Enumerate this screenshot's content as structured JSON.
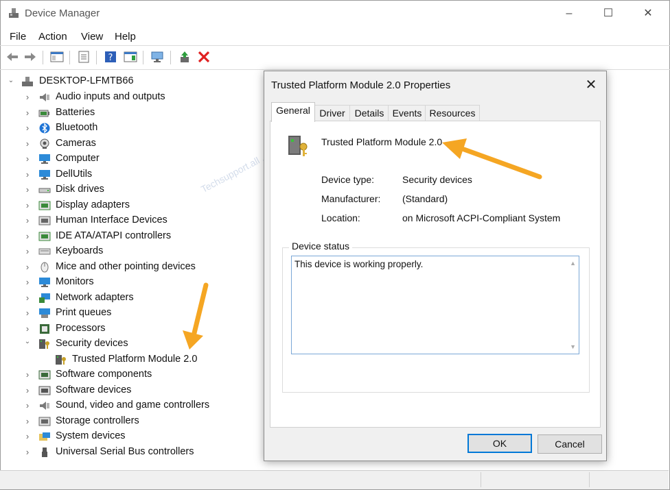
{
  "window": {
    "title": "Device Manager",
    "controls": {
      "minimize": "–",
      "maximize": "☐",
      "close": "✕"
    }
  },
  "menu": [
    "File",
    "Action",
    "View",
    "Help"
  ],
  "tree": {
    "root": "DESKTOP-LFMTB66",
    "items": [
      {
        "label": "Audio inputs and outputs",
        "icon": "speaker-icon",
        "color": "#7a7a7a"
      },
      {
        "label": "Batteries",
        "icon": "battery-icon",
        "color": "#3a8a3a"
      },
      {
        "label": "Bluetooth",
        "icon": "bluetooth-icon",
        "color": "#1e74d6"
      },
      {
        "label": "Cameras",
        "icon": "camera-icon",
        "color": "#555555"
      },
      {
        "label": "Computer",
        "icon": "monitor-icon",
        "color": "#2c8ad8"
      },
      {
        "label": "DellUtils",
        "icon": "monitor-icon",
        "color": "#2c8ad8"
      },
      {
        "label": "Disk drives",
        "icon": "disk-icon",
        "color": "#666666"
      },
      {
        "label": "Display adapters",
        "icon": "display-adapter-icon",
        "color": "#3a8a3a"
      },
      {
        "label": "Human Interface Devices",
        "icon": "hid-icon",
        "color": "#666666"
      },
      {
        "label": "IDE ATA/ATAPI controllers",
        "icon": "ide-icon",
        "color": "#3a8a3a"
      },
      {
        "label": "Keyboards",
        "icon": "keyboard-icon",
        "color": "#777777"
      },
      {
        "label": "Mice and other pointing devices",
        "icon": "mouse-icon",
        "color": "#777777"
      },
      {
        "label": "Monitors",
        "icon": "monitor-icon",
        "color": "#2c8ad8"
      },
      {
        "label": "Network adapters",
        "icon": "network-icon",
        "color": "#2c8ad8"
      },
      {
        "label": "Print queues",
        "icon": "printer-icon",
        "color": "#2c8ad8"
      },
      {
        "label": "Processors",
        "icon": "cpu-icon",
        "color": "#3a6a3a"
      },
      {
        "label": "Security devices",
        "icon": "security-key-icon",
        "color": "#c9a227",
        "expanded": true
      },
      {
        "label": "Trusted Platform Module 2.0",
        "icon": "security-key-icon",
        "color": "#c9a227",
        "child": true
      },
      {
        "label": "Software components",
        "icon": "software-component-icon",
        "color": "#3a6a3a"
      },
      {
        "label": "Software devices",
        "icon": "software-device-icon",
        "color": "#555555"
      },
      {
        "label": "Sound, video and game controllers",
        "icon": "speaker-icon",
        "color": "#7a7a7a"
      },
      {
        "label": "Storage controllers",
        "icon": "storage-icon",
        "color": "#666666"
      },
      {
        "label": "System devices",
        "icon": "folder-monitor-icon",
        "color": "#2c8ad8"
      },
      {
        "label": "Universal Serial Bus controllers",
        "icon": "usb-icon",
        "color": "#555555"
      }
    ]
  },
  "dialog": {
    "title": "Trusted Platform Module 2.0 Properties",
    "close": "✕",
    "tabs": [
      "General",
      "Driver",
      "Details",
      "Events",
      "Resources"
    ],
    "device_name": "Trusted Platform Module 2.0",
    "fields": [
      {
        "label": "Device type:",
        "value": "Security devices"
      },
      {
        "label": "Manufacturer:",
        "value": "(Standard)"
      },
      {
        "label": "Location:",
        "value": "on Microsoft ACPI-Compliant System"
      }
    ],
    "status_group": "Device status",
    "status_text": "This device is working properly.",
    "ok": "OK",
    "cancel": "Cancel"
  },
  "watermark": "Techsupport.all .com",
  "colors": {
    "arrow": "#f5a623",
    "focus": "#0078d7"
  }
}
